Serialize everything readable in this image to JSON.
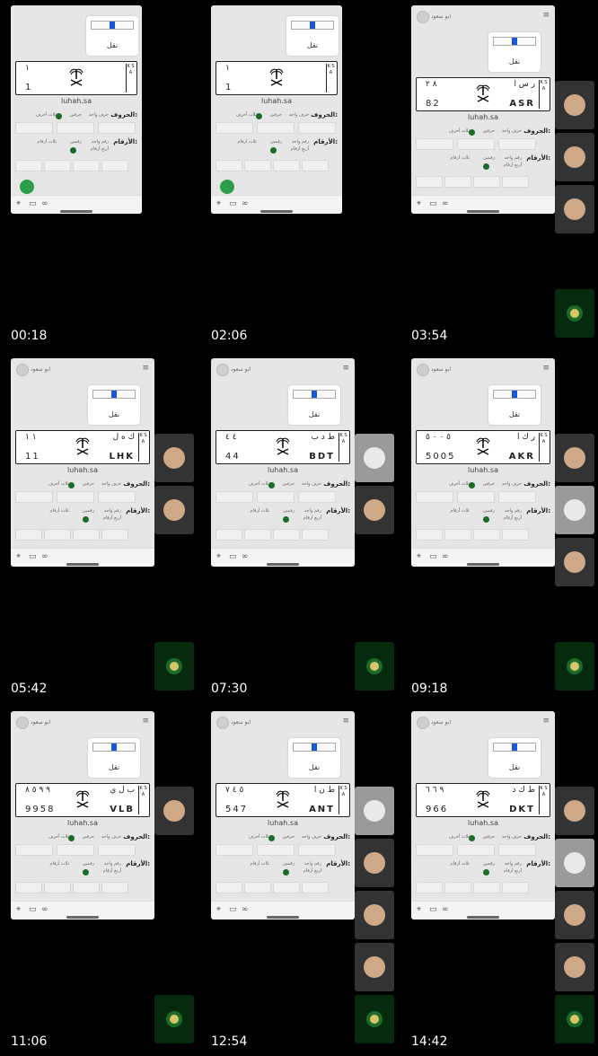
{
  "frames": [
    {
      "time": "00:18",
      "title": null,
      "letters_ar": "",
      "letters_en": "",
      "nums_ar": "١",
      "nums_en": "1",
      "site": "luhah.sa",
      "letters_label": "الحروف:",
      "numbers_label": "الأرقام:"
    },
    {
      "time": "02:06",
      "title": null,
      "letters_ar": "",
      "letters_en": "",
      "nums_ar": "١",
      "nums_en": "1",
      "site": "luhah.sa",
      "letters_label": "الحروف:",
      "numbers_label": "الأرقام:"
    },
    {
      "time": "03:54",
      "title": "ابو سعود",
      "letters_ar": "ر س ا",
      "letters_en": "ASR",
      "nums_ar": "٨ ٢",
      "nums_en": "82",
      "site": "luhah.sa",
      "letters_label": "الحروف:",
      "numbers_label": "الأرقام:"
    },
    {
      "time": "05:42",
      "title": "ابو سعود",
      "letters_ar": "ك ه ل",
      "letters_en": "LHK",
      "nums_ar": "١ ١",
      "nums_en": "11",
      "site": "luhah.sa",
      "letters_label": "الحروف:",
      "numbers_label": "الأرقام:"
    },
    {
      "time": "07:30",
      "title": "ابو سعود",
      "letters_ar": "ط د ب",
      "letters_en": "BDT",
      "nums_ar": "٤ ٤",
      "nums_en": "44",
      "site": "luhah.sa",
      "letters_label": "الحروف:",
      "numbers_label": "الأرقام:"
    },
    {
      "time": "09:18",
      "title": "ابو سعود",
      "letters_ar": "ر ك ا",
      "letters_en": "AKR",
      "nums_ar": "٥ ٠ ٠ ٥",
      "nums_en": "5005",
      "site": "luhah.sa",
      "letters_label": "الحروف:",
      "numbers_label": "الأرقام:"
    },
    {
      "time": "11:06",
      "title": "ابو سعود",
      "letters_ar": "ب ل ي",
      "letters_en": "VLB",
      "nums_ar": "٩ ٩ ٥ ٨",
      "nums_en": "9958",
      "site": "luhah.sa",
      "letters_label": "الحروف:",
      "numbers_label": "الأرقام:"
    },
    {
      "time": "12:54",
      "title": "ابو سعود",
      "letters_ar": "ط ن ا",
      "letters_en": "ANT",
      "nums_ar": "٥ ٤ ٧",
      "nums_en": "547",
      "site": "luhah.sa",
      "letters_label": "الحروف:",
      "numbers_label": "الأرقام:"
    },
    {
      "time": "14:42",
      "title": "ابو سعود",
      "letters_ar": "ط ك د",
      "letters_en": "DKT",
      "nums_ar": "٩ ٦ ٦",
      "nums_en": "966",
      "site": "luhah.sa",
      "letters_label": "الحروف:",
      "numbers_label": "الأرقام:"
    }
  ],
  "common": {
    "naql_label": "نقل",
    "ksa": "K S A",
    "opt_one_letter": "حرف واحد",
    "opt_two_letters": "حرفين",
    "opt_three_letters": "ثلاث أحرف",
    "opt_one_number": "رقم واحد",
    "opt_two_numbers": "رقمين",
    "opt_three_numbers": "ثلاث أرقام",
    "opt_four_numbers": "أربع أرقام"
  },
  "colors": {
    "accent": "#1a57d6",
    "green": "#1b6b2a",
    "background": "#000000"
  }
}
